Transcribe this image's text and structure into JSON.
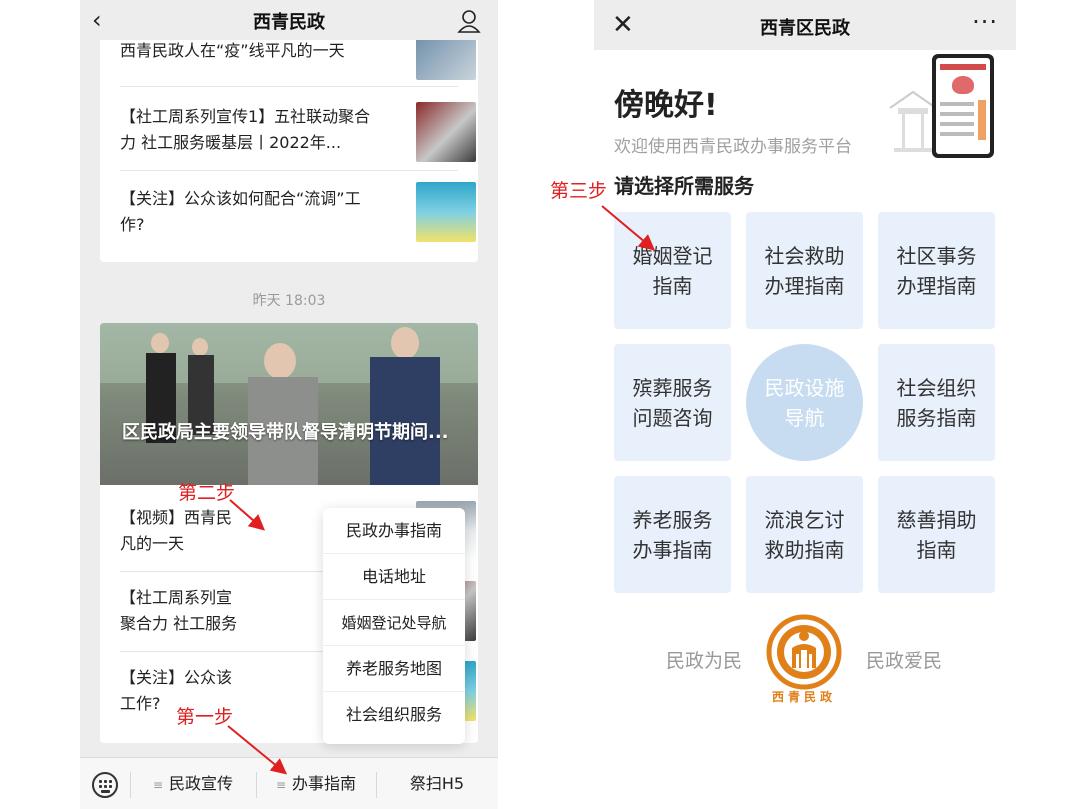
{
  "left": {
    "header": {
      "title": "西青民政"
    },
    "articles_top": [
      {
        "text": "西青民政人在“疫”线平凡的一天"
      },
      {
        "text": "【社工周系列宣传1】五社联动聚合力 社工服务暖基层丨2022年..."
      },
      {
        "text": "【关注】公众该如何配合“流调”工作?"
      }
    ],
    "timestamp": "昨天 18:03",
    "hero_caption": "区民政局主要领导带队督导清明节期间...",
    "articles_bottom": [
      {
        "text": "【视频】西青民 凡的一天"
      },
      {
        "text": "【社工周系列宣 聚合力 社工服务"
      },
      {
        "text": "【关注】公众该 工作?"
      }
    ],
    "popup_menu": [
      "民政办事指南",
      "电话地址",
      "婚姻登记处导航",
      "养老服务地图",
      "社会组织服务"
    ],
    "bottom_tabs": [
      "民政宣传",
      "办事指南",
      "祭扫H5"
    ],
    "steps": {
      "step1": "第一步",
      "step2": "第二步"
    }
  },
  "right": {
    "header": {
      "title": "西青区民政",
      "more": "···"
    },
    "greeting": "傍晚好!",
    "welcome": "欢迎使用西青民政办事服务平台",
    "choose": "请选择所需服务",
    "step3": "第三步",
    "tiles": [
      {
        "line1": "婚姻登记",
        "line2": "指南"
      },
      {
        "line1": "社会救助",
        "line2": "办理指南"
      },
      {
        "line1": "社区事务",
        "line2": "办理指南"
      },
      {
        "line1": "殡葬服务",
        "line2": "问题咨询"
      },
      {
        "line1": "民政设施",
        "line2": "导航"
      },
      {
        "line1": "社会组织",
        "line2": "服务指南"
      },
      {
        "line1": "养老服务",
        "line2": "办事指南"
      },
      {
        "line1": "流浪乞讨",
        "line2": "救助指南"
      },
      {
        "line1": "慈善捐助",
        "line2": "指南"
      }
    ],
    "footer": {
      "left": "民政为民",
      "right": "民政爱民",
      "logo_text": "西青民政"
    }
  },
  "colors": {
    "accent_red": "#e02020",
    "tile_bg": "#e8f1fb",
    "circle_bg": "#c7dcf0",
    "logo_orange": "#e08018"
  }
}
